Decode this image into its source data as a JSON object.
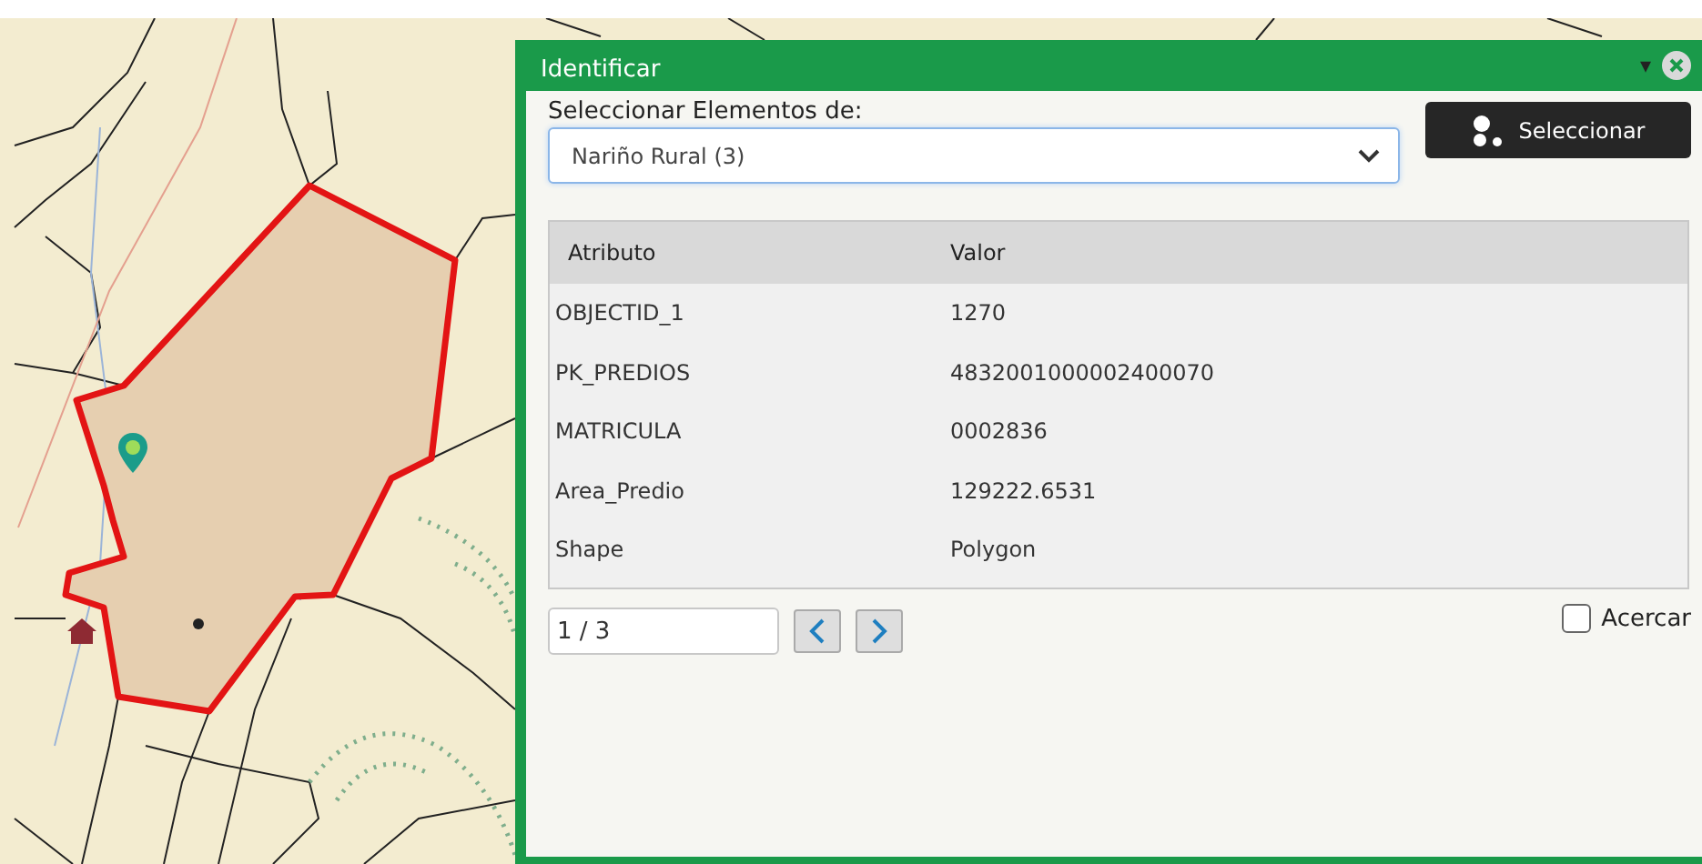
{
  "dialog": {
    "title": "Identificar",
    "collapse_icon": "▾",
    "source_label": "Seleccionar Elementos de:",
    "source_select": {
      "value": "Nariño Rural (3)"
    },
    "select_button": "Seleccionar",
    "table": {
      "columns": [
        "Atributo",
        "Valor"
      ],
      "rows": [
        {
          "attribute": "OBJECTID_1",
          "value": "1270"
        },
        {
          "attribute": "PK_PREDIOS",
          "value": "4832001000002400070"
        },
        {
          "attribute": "MATRICULA",
          "value": "0002836"
        },
        {
          "attribute": "Area_Predio",
          "value": "129222.6531"
        },
        {
          "attribute": "Shape",
          "value": "Polygon"
        }
      ]
    },
    "pager": {
      "value": "1 / 3"
    },
    "zoom_checkbox": {
      "label": "Acercar",
      "checked": false
    }
  }
}
